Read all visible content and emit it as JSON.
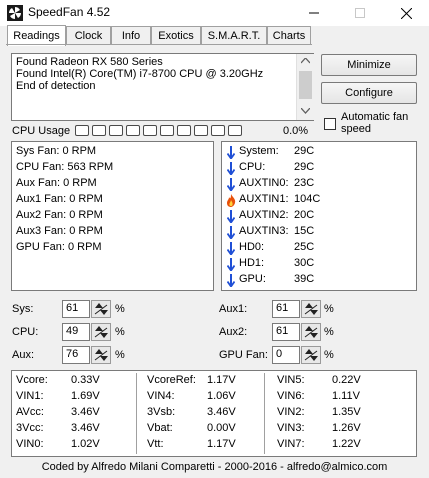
{
  "window": {
    "title": "SpeedFan 4.52"
  },
  "tabs": [
    "Readings",
    "Clock",
    "Info",
    "Exotics",
    "S.M.A.R.T.",
    "Charts"
  ],
  "log": [
    "Found Radeon RX 580 Series",
    "Found Intel(R) Core(TM) i7-8700 CPU @ 3.20GHz",
    "End of detection"
  ],
  "buttons": {
    "minimize": "Minimize",
    "configure": "Configure",
    "auto_fan": "Automatic fan speed"
  },
  "cpu_usage": {
    "label": "CPU Usage",
    "value": "0.0%",
    "cells": 10
  },
  "fans": [
    {
      "label": "Sys Fan:",
      "value": "0 RPM"
    },
    {
      "label": "CPU Fan:",
      "value": "563 RPM"
    },
    {
      "label": "Aux Fan:",
      "value": "0 RPM"
    },
    {
      "label": "Aux1 Fan:",
      "value": "0 RPM"
    },
    {
      "label": "Aux2 Fan:",
      "value": "0 RPM"
    },
    {
      "label": "Aux3 Fan:",
      "value": "0 RPM"
    },
    {
      "label": "GPU Fan:",
      "value": "0 RPM"
    }
  ],
  "temps": [
    {
      "label": "System:",
      "value": "29C",
      "icon": "arrow-down-icon"
    },
    {
      "label": "CPU:",
      "value": "29C",
      "icon": "arrow-down-icon"
    },
    {
      "label": "AUXTIN0:",
      "value": "23C",
      "icon": "arrow-down-icon"
    },
    {
      "label": "AUXTIN1:",
      "value": "104C",
      "icon": "flame-icon"
    },
    {
      "label": "AUXTIN2:",
      "value": "20C",
      "icon": "arrow-down-icon"
    },
    {
      "label": "AUXTIN3:",
      "value": "15C",
      "icon": "arrow-down-icon"
    },
    {
      "label": "HD0:",
      "value": "25C",
      "icon": "arrow-down-icon"
    },
    {
      "label": "HD1:",
      "value": "30C",
      "icon": "arrow-down-icon"
    },
    {
      "label": "GPU:",
      "value": "39C",
      "icon": "arrow-down-icon"
    }
  ],
  "speeds": {
    "sys": {
      "label": "Sys:",
      "value": "61",
      "unit": "%"
    },
    "cpu": {
      "label": "CPU:",
      "value": "49",
      "unit": "%"
    },
    "aux": {
      "label": "Aux:",
      "value": "76",
      "unit": "%"
    },
    "aux1": {
      "label": "Aux1:",
      "value": "61",
      "unit": "%"
    },
    "aux2": {
      "label": "Aux2:",
      "value": "61",
      "unit": "%"
    },
    "gpu_fan": {
      "label": "GPU Fan:",
      "value": "0",
      "unit": "%"
    }
  },
  "voltages": [
    [
      {
        "label": "Vcore:",
        "value": "0.33V"
      },
      {
        "label": "VIN1:",
        "value": "1.69V"
      },
      {
        "label": "AVcc:",
        "value": "3.46V"
      },
      {
        "label": "3Vcc:",
        "value": "3.46V"
      },
      {
        "label": "VIN0:",
        "value": "1.02V"
      }
    ],
    [
      {
        "label": "VcoreRef:",
        "value": "1.17V"
      },
      {
        "label": "VIN4:",
        "value": "1.06V"
      },
      {
        "label": "3Vsb:",
        "value": "3.46V"
      },
      {
        "label": "Vbat:",
        "value": "0.00V"
      },
      {
        "label": "Vtt:",
        "value": "1.17V"
      }
    ],
    [
      {
        "label": "VIN5:",
        "value": "0.22V"
      },
      {
        "label": "VIN6:",
        "value": "1.11V"
      },
      {
        "label": "VIN2:",
        "value": "1.35V"
      },
      {
        "label": "VIN3:",
        "value": "1.26V"
      },
      {
        "label": "VIN7:",
        "value": "1.22V"
      }
    ]
  ],
  "footer": "Coded by Alfredo Milani Comparetti - 2000-2016 - alfredo@almico.com",
  "colors": {
    "arrow": "#1f4fd6",
    "flame": "#e8500a"
  }
}
